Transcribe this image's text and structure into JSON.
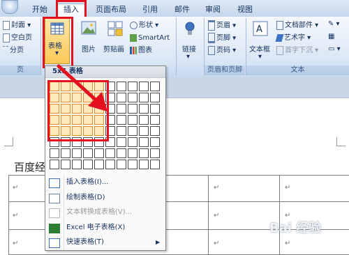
{
  "tabs": [
    "开始",
    "插入",
    "页面布局",
    "引用",
    "邮件",
    "审阅",
    "视图"
  ],
  "ribbon": {
    "pages": {
      "items": [
        "封面",
        "空白页",
        "分页"
      ],
      "label": "页"
    },
    "table": {
      "button_label": "表格"
    },
    "illustrations": {
      "picture": "图片",
      "clipart": "剪贴画",
      "shapes": "形状",
      "smartart": "SmartArt",
      "chart": "图表"
    },
    "links": {
      "link": "链接"
    },
    "header_footer": {
      "header": "页眉",
      "footer": "页脚",
      "page_number": "页码",
      "label": "页眉和页脚"
    },
    "text": {
      "textbox": "文本框",
      "quick_parts": "文档部件",
      "wordart": "艺术字",
      "drop_cap": "首字下沉",
      "label": "文本"
    }
  },
  "dropdown": {
    "title": "5x5 表格",
    "grid": {
      "cols": 10,
      "rows": 8,
      "selected_cols": 5,
      "selected_rows": 5
    },
    "items": [
      {
        "label": "插入表格(I)...",
        "icon": "insert-table-icon",
        "enabled": true
      },
      {
        "label": "绘制表格(D)",
        "icon": "draw-table-icon",
        "enabled": true
      },
      {
        "label": "文本转换成表格(V)...",
        "icon": "text-to-table-icon",
        "enabled": false
      },
      {
        "label": "Excel 电子表格(X)",
        "icon": "excel-icon",
        "enabled": true
      },
      {
        "label": "快速表格(T)",
        "icon": "quick-tables-icon",
        "enabled": true
      }
    ]
  },
  "document": {
    "text": "百度经",
    "cell_mark": "↵"
  },
  "watermark": "Bai 经验",
  "colors": {
    "highlight_red": "#e3101e",
    "grid_selected": "#e48a20",
    "ribbon_bg": "#dbe7f5"
  }
}
